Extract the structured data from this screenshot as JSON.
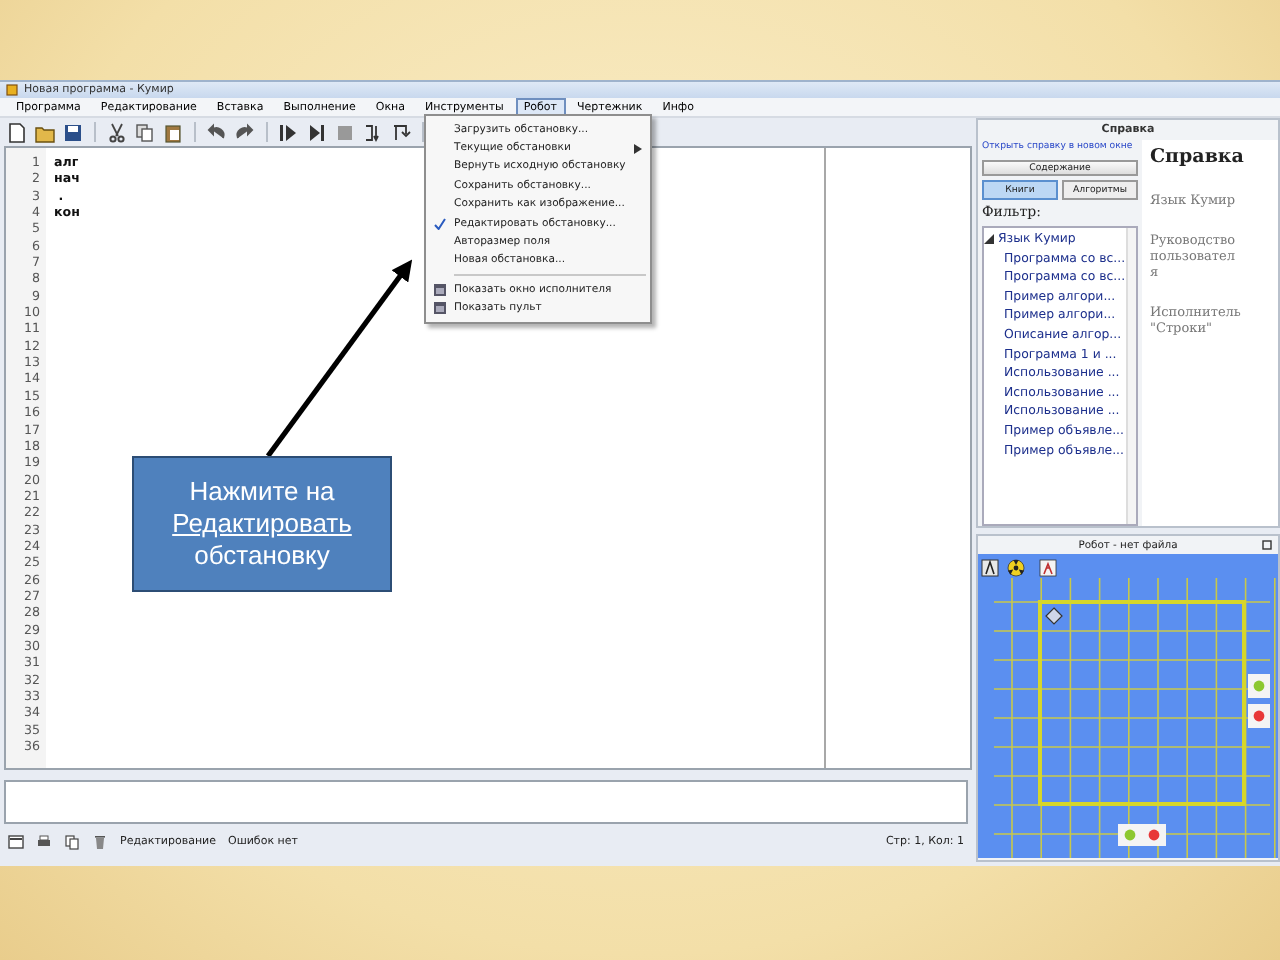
{
  "window": {
    "title": "Новая программа - Кумир"
  },
  "menu_bar": [
    {
      "label": "Программа",
      "selected": false
    },
    {
      "label": "Редактирование",
      "selected": false
    },
    {
      "label": "Вставка",
      "selected": false
    },
    {
      "label": "Выполнение",
      "selected": false
    },
    {
      "label": "Окна",
      "selected": false
    },
    {
      "label": "Инструменты",
      "selected": false
    },
    {
      "label": "Робот",
      "selected": true
    },
    {
      "label": "Чертежник",
      "selected": false
    },
    {
      "label": "Инфо",
      "selected": false
    }
  ],
  "robot_menu": [
    {
      "kind": "item",
      "label": "Загрузить обстановку...",
      "checked": false,
      "submenu": false
    },
    {
      "kind": "item",
      "label": "Текущие обстановки",
      "checked": false,
      "submenu": true
    },
    {
      "kind": "item",
      "label": "Вернуть исходную обстановку",
      "checked": false,
      "submenu": false
    },
    {
      "kind": "item",
      "label": "Сохранить обстановку...",
      "checked": false,
      "submenu": false
    },
    {
      "kind": "item",
      "label": "Сохранить как изображение...",
      "checked": false,
      "submenu": false
    },
    {
      "kind": "item",
      "label": "Редактировать обстановку...",
      "checked": true,
      "submenu": false
    },
    {
      "kind": "item",
      "label": "Авторазмер поля",
      "checked": false,
      "submenu": false
    },
    {
      "kind": "item",
      "label": "Новая обстановка...",
      "checked": false,
      "submenu": false
    },
    {
      "kind": "separator"
    },
    {
      "kind": "window-item",
      "label": "Показать окно исполнителя"
    },
    {
      "kind": "window-item",
      "label": "Показать пульт"
    }
  ],
  "editor": {
    "line_numbers": [
      "1",
      "2",
      "3",
      "4",
      "5",
      "6",
      "7",
      "8",
      "9",
      "10",
      "11",
      "12",
      "13",
      "14",
      "15",
      "16",
      "17",
      "18",
      "19",
      "20",
      "21",
      "22",
      "23",
      "24",
      "25",
      "26",
      "27",
      "28",
      "29",
      "30",
      "31",
      "32",
      "33",
      "34",
      "35",
      "36"
    ],
    "code_lines": [
      "алг",
      "нач",
      " .",
      "кон"
    ]
  },
  "status_bar": {
    "mode": "Редактирование",
    "errors": "Ошибок нет",
    "position": "Стр: 1, Кол: 1"
  },
  "help": {
    "title": "Справка",
    "link": "Открыть справку в новом окне",
    "button": "Содержание",
    "tabs": [
      {
        "label": "Книги",
        "selected": true
      },
      {
        "label": "Алгоритмы",
        "selected": false
      }
    ],
    "filter_label": "Фильтр:",
    "tree": [
      {
        "label": "Язык Кумир",
        "expanded": true,
        "children": [
          {
            "label": "Программа со вс..."
          },
          {
            "label": "Программа со вс..."
          },
          {
            "label": "Пример алгори..."
          },
          {
            "label": "Пример алгори..."
          },
          {
            "label": "Описание алгор..."
          },
          {
            "label": "Программа 1 и ..."
          },
          {
            "label": "Использование ..."
          },
          {
            "label": "Использование ..."
          },
          {
            "label": "Использование ..."
          },
          {
            "label": "Пример объявле..."
          },
          {
            "label": "Пример объявле..."
          }
        ]
      }
    ],
    "content_title": "Справка",
    "content_items": [
      "Язык Кумир",
      "Руководство пользователя",
      "Исполнитель \"Строки\""
    ]
  },
  "robot": {
    "title": "Робот - нет файла"
  },
  "callout": {
    "text": "Нажмите на",
    "link": "Редактировать",
    "suffix": "обстановку"
  }
}
